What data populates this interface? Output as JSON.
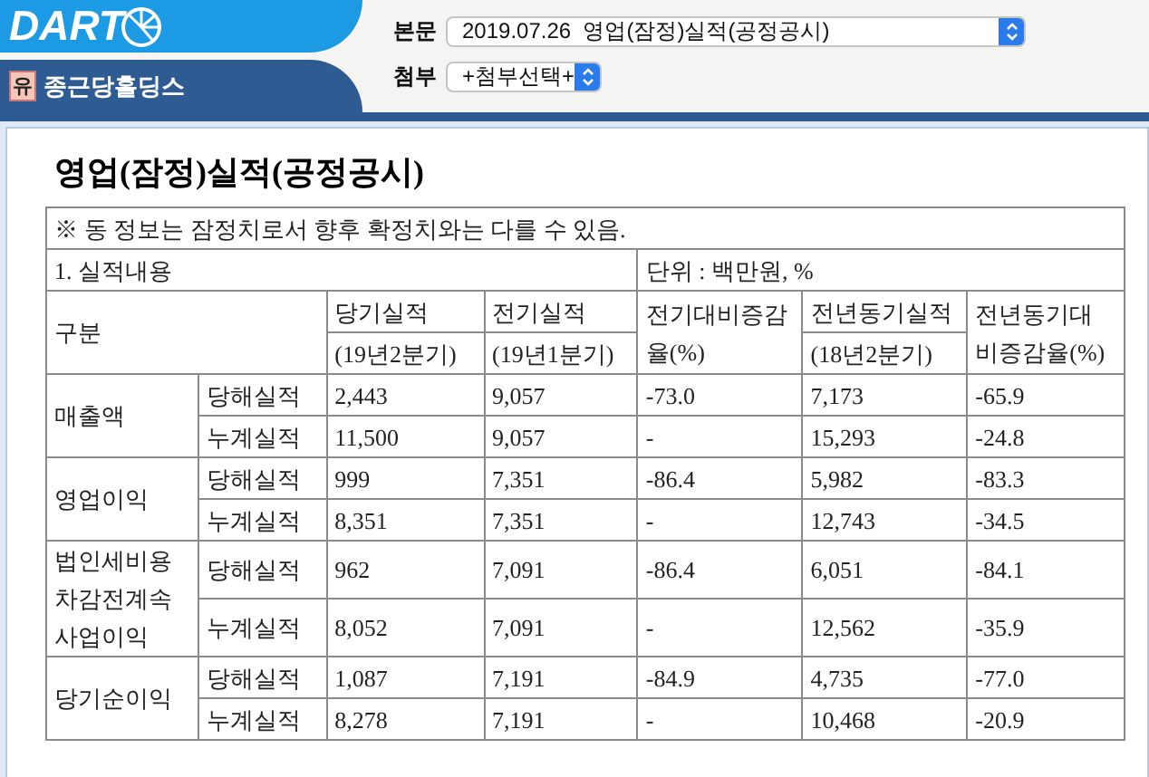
{
  "header": {
    "logo": "DART",
    "company_badge": "유",
    "company": "종근당홀딩스",
    "fields": [
      {
        "label": "본문",
        "value": "2019.07.26  영업(잠정)실적(공정공시)",
        "kind": "wide"
      },
      {
        "label": "첨부",
        "value": "+첨부선택+",
        "kind": "narrow"
      }
    ]
  },
  "document": {
    "title": "영업(잠정)실적(공정공시)",
    "note": "※ 동 정보는 잠정치로서 향후 확정치와는 다를 수 있음.",
    "section": "1. 실적내용",
    "unit": "단위 : 백만원, %",
    "group_header": "구분",
    "columns": [
      {
        "label": "당기실적",
        "period": "(19년2분기)"
      },
      {
        "label": "전기실적",
        "period": "(19년1분기)"
      },
      {
        "label": "전기대비증감율(%)"
      },
      {
        "label": "전년동기실적",
        "period": "(18년2분기)"
      },
      {
        "label": "전년동기대비증감율(%)"
      }
    ],
    "rows": [
      {
        "item": "매출액",
        "lines": [
          {
            "period": "당해실적",
            "values": [
              "2,443",
              "9,057",
              "-73.0",
              "7,173",
              "-65.9"
            ]
          },
          {
            "period": "누계실적",
            "values": [
              "11,500",
              "9,057",
              "-",
              "15,293",
              "-24.8"
            ]
          }
        ]
      },
      {
        "item": "영업이익",
        "lines": [
          {
            "period": "당해실적",
            "values": [
              "999",
              "7,351",
              "-86.4",
              "5,982",
              "-83.3"
            ]
          },
          {
            "period": "누계실적",
            "values": [
              "8,351",
              "7,351",
              "-",
              "12,743",
              "-34.5"
            ]
          }
        ]
      },
      {
        "item": "법인세비용차감전계속사업이익",
        "lines": [
          {
            "period": "당해실적",
            "values": [
              "962",
              "7,091",
              "-86.4",
              "6,051",
              "-84.1"
            ]
          },
          {
            "period": "누계실적",
            "values": [
              "8,052",
              "7,091",
              "-",
              "12,562",
              "-35.9"
            ]
          }
        ]
      },
      {
        "item": "당기순이익",
        "lines": [
          {
            "period": "당해실적",
            "values": [
              "1,087",
              "7,191",
              "-84.9",
              "4,735",
              "-77.0"
            ]
          },
          {
            "period": "누계실적",
            "values": [
              "8,278",
              "7,191",
              "-",
              "10,468",
              "-20.9"
            ]
          }
        ]
      }
    ]
  }
}
